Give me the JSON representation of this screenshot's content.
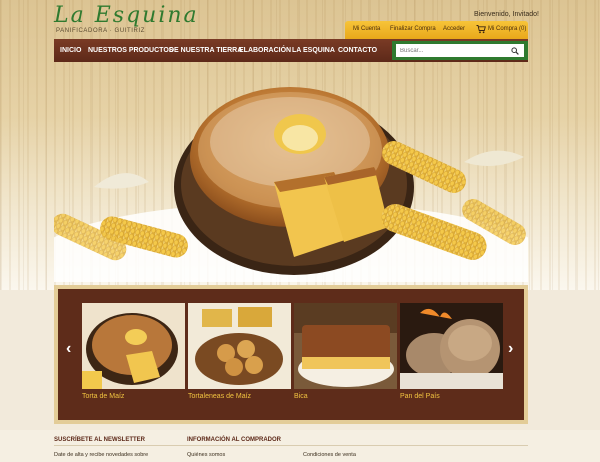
{
  "brand": {
    "name": "La Esquina",
    "tagline": "PANIFICADORA · GUITIRIZ",
    "color": "#2f7a2f"
  },
  "account": {
    "welcome": "Bienvenido, Invitado!",
    "links": [
      "Mi Cuenta",
      "Finalizar Compra",
      "Acceder"
    ],
    "cart": "Mi Compra (0)"
  },
  "nav": {
    "items": [
      "INICIO",
      "NUESTROS PRODUCTOS",
      "DE NUESTRA TIERRA",
      "ELABORACIÓN",
      "LA ESQUINA",
      "CONTACTO"
    ]
  },
  "search": {
    "placeholder": "Buscar..."
  },
  "carousel": {
    "prev_icon": "chevron-left-icon",
    "next_icon": "chevron-right-icon",
    "items": [
      {
        "label": "Torta de Maíz"
      },
      {
        "label": "Tortaleneas de Maíz"
      },
      {
        "label": "Bica"
      },
      {
        "label": "Pan del País"
      }
    ]
  },
  "footer": {
    "newsletter_title": "SUSCRÍBETE AL NEWSLETTER",
    "newsletter_text": "Date de alta y recibe novedades sobre",
    "info_title": "INFORMACIÓN AL COMPRADOR",
    "info_links": [
      "Quiénes somos",
      "Condiciones de venta"
    ]
  },
  "colors": {
    "nav_bg": "#6b3220",
    "accent_gold": "#f1c340",
    "account_bar": "#eeb42a"
  }
}
